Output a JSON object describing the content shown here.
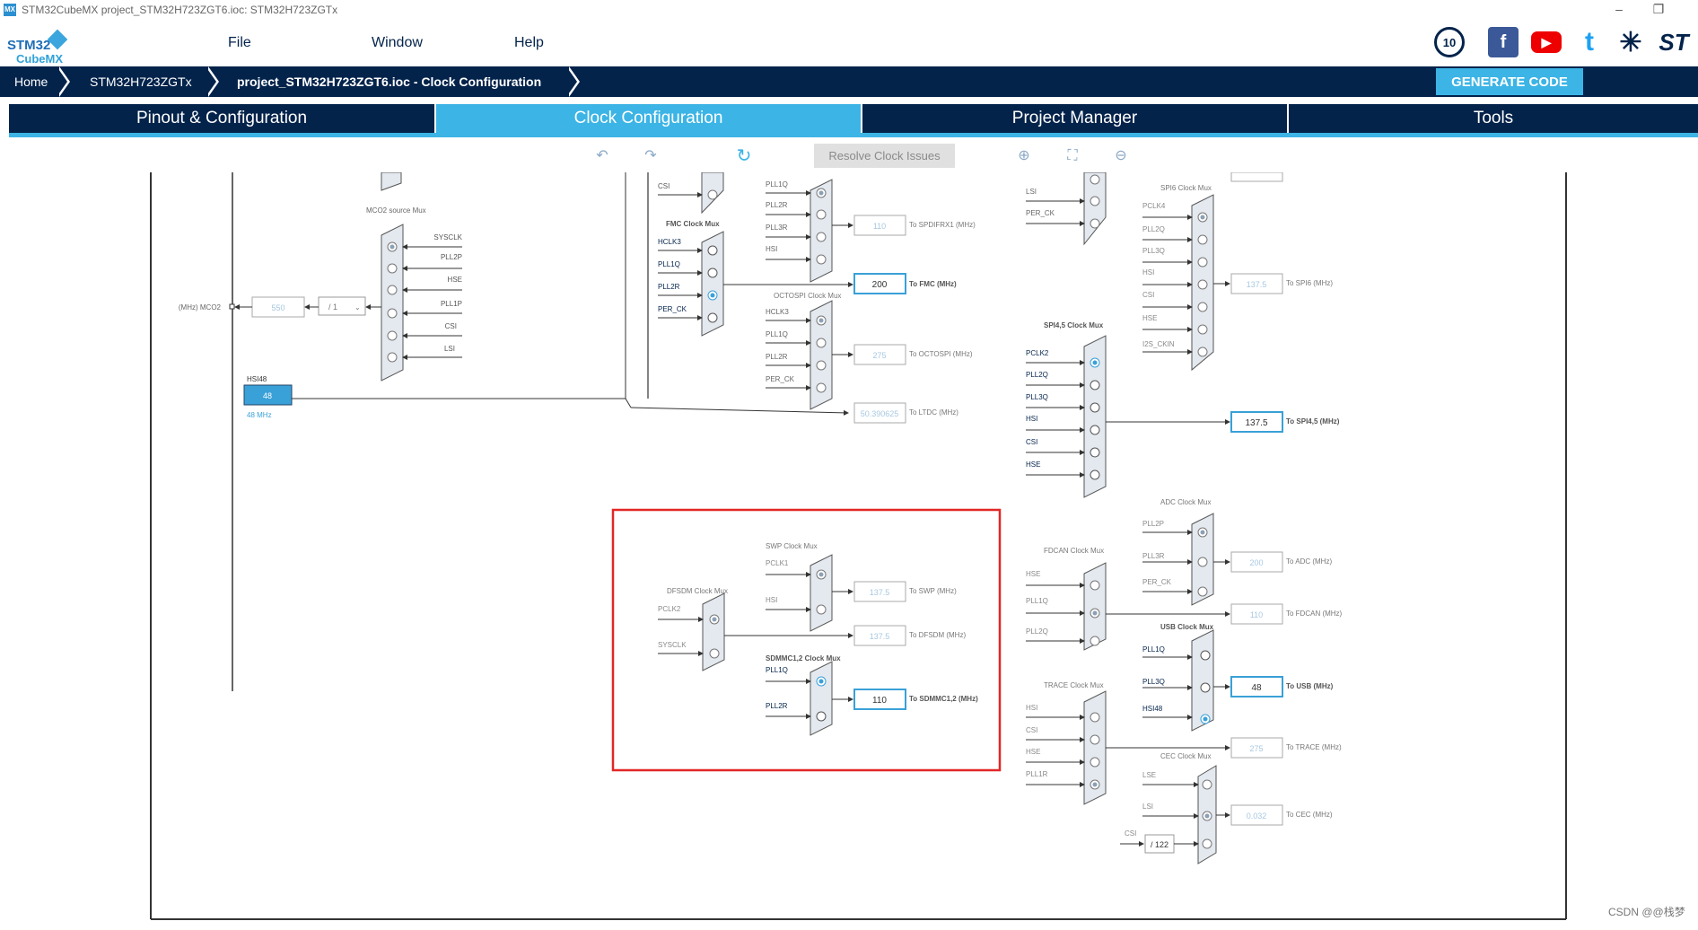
{
  "window": {
    "title": "STM32CubeMX project_STM32H723ZGT6.ioc: STM32H723ZGTx",
    "app_icon_text": "MX",
    "minimize": "–",
    "restore": "❐",
    "close": "✕"
  },
  "logo": {
    "line1": "STM32",
    "line2": "CubeMX"
  },
  "menu": {
    "file": "File",
    "window": "Window",
    "help": "Help"
  },
  "social": {
    "anniversary": "10",
    "facebook": "f",
    "youtube": "▶",
    "twitter": "t",
    "network": "✳",
    "st": "ST"
  },
  "breadcrumb": {
    "home": "Home",
    "device": "STM32H723ZGTx",
    "project": "project_STM32H723ZGT6.ioc - Clock Configuration"
  },
  "generate_code": "GENERATE CODE",
  "tabs": [
    "Pinout & Configuration",
    "Clock Configuration",
    "Project Manager",
    "Tools"
  ],
  "toolbar": {
    "undo": "↶",
    "redo": "↷",
    "refresh": "↻",
    "resolve": "Resolve Clock Issues",
    "zoom_in": "⊕",
    "fit": "⛶",
    "zoom_out": "⊖"
  },
  "diagram": {
    "mco2": {
      "title": "MCO2 source Mux",
      "inputs": [
        "SYSCLK",
        "PLL2P",
        "HSE",
        "PLL1P",
        "CSI",
        "LSI"
      ],
      "divider": "/ 1",
      "value": "550",
      "output": "(MHz) MCO2"
    },
    "hsi48": {
      "label": "HSI48",
      "value": "48",
      "unit": "48 MHz"
    },
    "fmc": {
      "title": "FMC Clock Mux",
      "inputs": [
        "HCLK3",
        "PLL1Q",
        "PLL2R",
        "PER_CK"
      ],
      "value": "200",
      "output": "To FMC (MHz)"
    },
    "spdif": {
      "inputs": [
        "PLL1Q",
        "PLL2R",
        "PLL3R",
        "HSI"
      ],
      "value": "110",
      "output": "To SPDIFRX1 (MHz)",
      "top_input": "CSI"
    },
    "octospi": {
      "title": "OCTOSPI Clock Mux",
      "inputs": [
        "HCLK3",
        "PLL1Q",
        "PLL2R",
        "PER_CK"
      ],
      "value": "275",
      "output": "To OCTOSPI (MHz)"
    },
    "ltdc": {
      "value": "50.390625",
      "output": "To LTDC (MHz)"
    },
    "swp": {
      "title": "SWP Clock Mux",
      "inputs": [
        "PCLK1",
        "HSI"
      ],
      "value": "137.5",
      "output": "To SWP (MHz)"
    },
    "dfsdm": {
      "title": "DFSDM Clock Mux",
      "inputs": [
        "PCLK2",
        "SYSCLK"
      ],
      "value": "137.5",
      "output": "To DFSDM (MHz)"
    },
    "sdmmc": {
      "title": "SDMMC1,2 Clock Mux",
      "inputs": [
        "PLL1Q",
        "PLL2R"
      ],
      "value": "110",
      "output": "To SDMMC1,2 (MHz)"
    },
    "right_top": {
      "inputs": [
        "LSI",
        "PER_CK"
      ]
    },
    "spi6": {
      "title": "SPI6 Clock Mux",
      "inputs": [
        "PCLK4",
        "PLL2Q",
        "PLL3Q",
        "HSI",
        "CSI",
        "HSE",
        "I2S_CKIN"
      ],
      "value": "137.5",
      "output": "To SPI6 (MHz)"
    },
    "spi45": {
      "title": "SPI4,5 Clock Mux",
      "inputs": [
        "PCLK2",
        "PLL2Q",
        "PLL3Q",
        "HSI",
        "CSI",
        "HSE"
      ],
      "value": "137.5",
      "output": "To SPI4,5 (MHz)"
    },
    "adc": {
      "title": "ADC Clock Mux",
      "inputs": [
        "PLL2P",
        "PLL3R",
        "PER_CK"
      ],
      "value": "200",
      "output": "To ADC (MHz)"
    },
    "fdcan": {
      "title": "FDCAN Clock Mux",
      "inputs": [
        "HSE",
        "PLL1Q",
        "PLL2Q"
      ],
      "value": "110",
      "output": "To FDCAN (MHz)"
    },
    "usb": {
      "title": "USB Clock Mux",
      "inputs": [
        "PLL1Q",
        "PLL3Q",
        "HSI48"
      ],
      "value": "48",
      "output": "To USB (MHz)"
    },
    "trace": {
      "title": "TRACE Clock Mux",
      "inputs": [
        "HSI",
        "CSI",
        "HSE",
        "PLL1R"
      ],
      "value": "275",
      "output": "To TRACE (MHz)"
    },
    "cec": {
      "title": "CEC Clock Mux",
      "inputs": [
        "LSE",
        "LSI",
        "CSI"
      ],
      "divider": "/ 122",
      "value": "0.032",
      "output": "To CEC (MHz)"
    }
  },
  "watermark": "CSDN @@栈梦",
  "colors": {
    "navy": "#03234b",
    "accent": "#3cb4e5",
    "highlight": "#e32626"
  }
}
